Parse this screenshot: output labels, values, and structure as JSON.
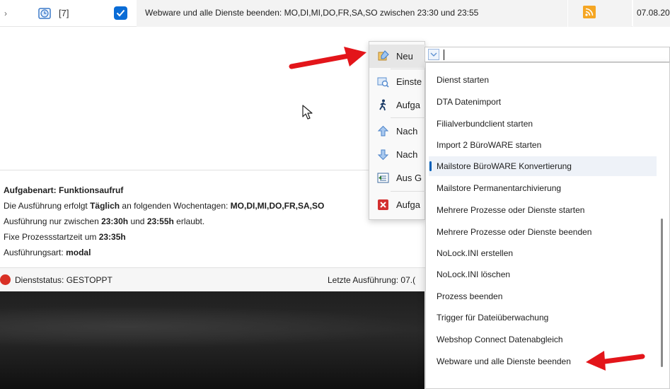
{
  "task_row": {
    "count": "[7]",
    "description": "Webware und alle Dienste beenden: MO,DI,MI,DO,FR,SA,SO zwischen 23:30 und 23:55",
    "date": "07.08.20"
  },
  "details": {
    "title": "Aufgabenart: Funktionsaufruf",
    "line1_prefix": "Die Ausführung erfolgt ",
    "line1_freq": "Täglich",
    "line1_mid": " an folgenden Wochentagen: ",
    "line1_days": "MO,DI,MI,DO,FR,SA,SO",
    "line2_prefix": "Ausführung nur zwischen ",
    "line2_from": "23:30h",
    "line2_mid": " und ",
    "line2_to": "23:55h",
    "line2_suffix": " erlaubt.",
    "line3_prefix": "Fixe Prozessstartzeit um ",
    "line3_time": "23:35h",
    "line4_prefix": "Ausführungsart: ",
    "line4_mode": "modal"
  },
  "status_bar": {
    "status": "Dienststatus: GESTOPPT",
    "last_run": "Letzte Ausführung: 07.("
  },
  "context_menu": {
    "items": [
      {
        "label": "Neu",
        "icon": "new-task-icon"
      },
      {
        "label": "Einste",
        "icon": "settings-icon"
      },
      {
        "label": "Aufga",
        "icon": "run-task-icon"
      },
      {
        "label": "Nach",
        "icon": "move-up-icon"
      },
      {
        "label": "Nach",
        "icon": "move-down-icon"
      },
      {
        "label": "Aus G",
        "icon": "remove-group-icon"
      },
      {
        "label": "Aufga",
        "icon": "delete-task-icon"
      }
    ]
  },
  "dropdown": {
    "input_value": "",
    "options": [
      "Dienst starten",
      "DTA Datenimport",
      "Filialverbundclient starten",
      "Import 2 BüroWARE starten",
      "Mailstore BüroWARE Konvertierung",
      "Mailstore Permanentarchivierung",
      "Mehrere Prozesse oder Dienste starten",
      "Mehrere Prozesse oder Dienste beenden",
      "NoLock.INI erstellen",
      "NoLock.INI löschen",
      "Prozess beenden",
      "Trigger für Dateiüberwachung",
      "Webshop Connect Datenabgleich",
      "Webware und alle Dienste beenden"
    ],
    "selected_index": 4
  },
  "colors": {
    "accent": "#0a6cd6",
    "annotation_red": "#e3151a",
    "status_error": "#d93025"
  }
}
